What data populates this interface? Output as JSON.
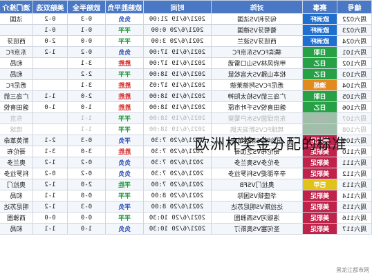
{
  "headers": [
    "编号",
    "赛事",
    "对阵",
    "时间",
    "欧赔胜平负",
    "欧赔半全",
    "美赔双选",
    "澳门推介"
  ],
  "rows": [
    {
      "id": "周六022",
      "league": "欧洲杯",
      "league_color": "#1f6fd1",
      "match": "匈牙利VS法国",
      "time": "2021/6/19 21:00",
      "bet": "负负",
      "bet_color": "blue",
      "half": "0-3",
      "shuang": "0-2",
      "macau": "法国"
    },
    {
      "id": "周六023",
      "league": "欧洲杯",
      "league_color": "#1f6fd1",
      "match": "葡萄牙VS德国",
      "time": "2021/6/20 0:00",
      "bet": "平平",
      "bet_color": "green",
      "half": "0-1",
      "shuang": "0-1",
      "macau": ""
    },
    {
      "id": "周六024",
      "league": "欧洲杯",
      "league_color": "#1f6fd1",
      "match": "西班牙VS波兰",
      "time": "2021/6/20 3:00",
      "bet": "平平",
      "bet_color": "green",
      "half": "0-0",
      "shuang": "2-0",
      "macau": "西班牙"
    },
    {
      "id": "周六101",
      "league": "日职",
      "league_color": "#27a146",
      "match": "横滨FCVS东京FC",
      "time": "2021/6/19 17:00",
      "bet": "负负",
      "bet_color": "blue",
      "half": "0-2",
      "shuang": "1-2",
      "macau": "东京FC"
    },
    {
      "id": "周六102",
      "league": "日乙",
      "league_color": "#27a146",
      "match": "甲府风林VS山口雷诺",
      "time": "2021/6/19 17:00",
      "bet": "胜胜",
      "bet_color": "red",
      "half": "3-1",
      "shuang": "",
      "macau": "和局"
    },
    {
      "id": "周六103",
      "league": "日乙",
      "league_color": "#27a146",
      "match": "松本山雅VS大宫松鼠",
      "time": "2021/6/19 18:00",
      "bet": "平平",
      "bet_color": "green",
      "half": "2-2",
      "shuang": "",
      "macau": "和局"
    },
    {
      "id": "周六104",
      "league": "澳超",
      "league_color": "#e38a1e",
      "match": "悉尼FCVS阿德莱德",
      "time": "2021/6/19 17:05",
      "bet": "胜胜",
      "bet_color": "red",
      "half": "3-1",
      "shuang": "",
      "macau": "悉尼FC"
    },
    {
      "id": "周六105",
      "league": "日职",
      "league_color": "#27a146",
      "match": "广岛三箭VS柏太阳神",
      "time": "2021/6/19 18:00",
      "bet": "胜胜",
      "bet_color": "red",
      "half": "2-0",
      "shuang": "1-1",
      "macau": "广岛三箭"
    },
    {
      "id": "周六106",
      "league": "日乙",
      "league_color": "#27a146",
      "match": "磐田喜悦VS千叶市原",
      "time": "2021/6/19 18:00",
      "bet": "胜胜",
      "bet_color": "red",
      "half": "1-0",
      "shuang": "1-0",
      "macau": "磐田喜悦"
    },
    {
      "id": "周六107",
      "league": "日乙",
      "league_color": "#9fbfa8",
      "match": "东京绿茵VS水户蜀葵",
      "time": "2021/6/19 18:00",
      "bet": "平平",
      "bet_color": "green",
      "half": "1-1",
      "shuang": "",
      "macau": "东京",
      "dim": true
    },
    {
      "id": "周六108",
      "league": "日乙",
      "league_color": "#9fbfa8",
      "match": "琉球FCVS新潟天鹅",
      "time": "2021/6/19 18:00",
      "bet": "平平",
      "bet_color": "green",
      "half": "1-1",
      "shuang": "",
      "macau": "琉球",
      "dim": true
    },
    {
      "id": "周六109",
      "league": "美职足",
      "league_color": "#c0224a",
      "match": "纽约城VS新英革命",
      "time": "2021/6/20 7:30",
      "bet": "平负",
      "bet_color": "blue",
      "half": "0-3",
      "shuang": "2-1",
      "macau": "新英革命"
    },
    {
      "id": "周六110",
      "league": "美职足",
      "league_color": "#c0224a",
      "match": "哥伦布VS芝加哥",
      "time": "2021/6/20 7:30",
      "bet": "胜胜",
      "bet_color": "red",
      "half": "3-0",
      "shuang": "3-1",
      "macau": "哥伦布"
    },
    {
      "id": "周六111",
      "league": "美职足",
      "league_color": "#c0224a",
      "match": "多伦多VS奥兰多",
      "time": "2021/6/20 7:30",
      "bet": "负负",
      "bet_color": "blue",
      "half": "0-2",
      "shuang": "1-2",
      "macau": "奥兰多"
    },
    {
      "id": "周六112",
      "league": "美职足",
      "league_color": "#c0224a",
      "match": "辛辛那提VS科罗拉多",
      "time": "2021/6/20 7:30",
      "bet": "负负",
      "bet_color": "blue",
      "half": "0-2",
      "shuang": "0-2",
      "macau": "科罗拉多"
    },
    {
      "id": "周六113",
      "league": "巴甲",
      "league_color": "#e0c31a",
      "match": "奥拉门VSFB",
      "time": "2021/6/20 7:00",
      "bet": "平胜",
      "bet_color": "green",
      "half": "2-0",
      "shuang": "1-2",
      "macau": "奥拉门"
    },
    {
      "id": "周六114",
      "league": "美职足",
      "league_color": "#c0224a",
      "match": "华盛顿VS国际",
      "time": "2021/6/20 8:00",
      "bet": "平平",
      "bet_color": "green",
      "half": "0-0",
      "shuang": "1-1",
      "macau": "和局"
    },
    {
      "id": "周六115",
      "league": "美职足",
      "league_color": "#c0224a",
      "match": "达拉斯VS明尼苏达",
      "time": "2021/6/20 8:00",
      "bet": "平负",
      "bet_color": "blue",
      "half": "0-3",
      "shuang": "1-2",
      "macau": "明尼苏达"
    },
    {
      "id": "周六116",
      "league": "美职足",
      "league_color": "#c0224a",
      "match": "洛银河VS西雅图",
      "time": "2021/6/20 10:30",
      "bet": "平平",
      "bet_color": "green",
      "half": "0-0",
      "shuang": "0-0",
      "macau": "西雅图"
    },
    {
      "id": "周六117",
      "league": "美职足",
      "league_color": "#c0224a",
      "match": "圣何塞VS奥斯汀",
      "time": "2021/6/20 10:30",
      "bet": "负负",
      "bet_color": "blue",
      "half": "1-0",
      "shuang": "1-1",
      "macau": "和局"
    }
  ],
  "overlay_text": "欧洲杯奖金分配的标准",
  "watermark": "黑龙江都市网"
}
